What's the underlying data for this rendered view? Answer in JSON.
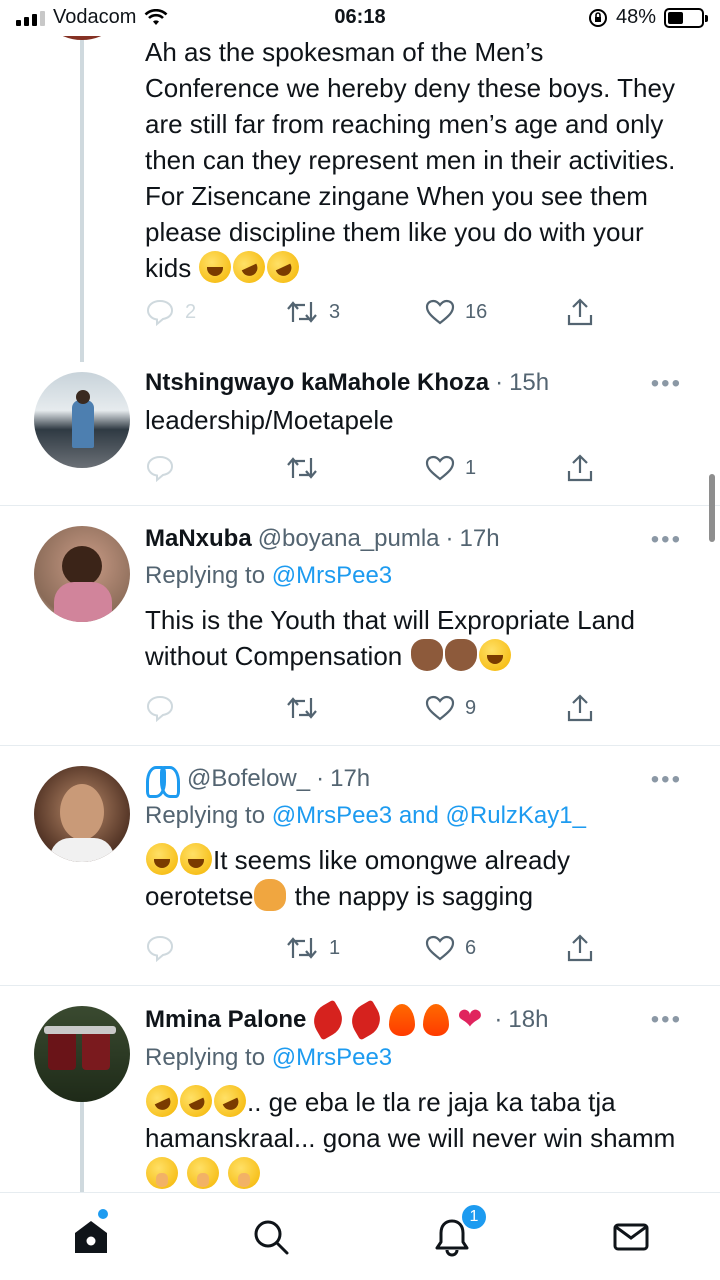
{
  "status_bar": {
    "carrier": "Vodacom",
    "time": "06:18",
    "battery_percent": "48%",
    "battery_level": 0.48
  },
  "tweets": [
    {
      "text": "Ah as the spokesman of the Men’s Conference we hereby deny these boys. They are still far from reaching men’s age and only then can they represent men in their activities. For Zisencane zingane When you see them please discipline them like you do with your kids",
      "emojis": [
        "face-with-tears-of-joy",
        "rolling-on-floor-laughing",
        "rolling-on-floor-laughing"
      ],
      "replies": "2",
      "retweets": "3",
      "likes": "16"
    },
    {
      "name": "Ntshingwayo kaMahole Khoza",
      "time": "15h",
      "text": "leadership/Moetapele",
      "replies": "",
      "retweets": "",
      "likes": "1"
    },
    {
      "name": "MaNxuba",
      "handle": "@boyana_pumla",
      "time": "17h",
      "replying_prefix": "Replying to",
      "replying_to": "@MrsPee3",
      "text": "This is the Youth that will Expropriate Land without Compensation",
      "emojis": [
        "clapping-hands",
        "clapping-hands",
        "face-with-tears-of-joy"
      ],
      "replies": "",
      "retweets": "",
      "likes": "9"
    },
    {
      "handle": "@Bofelow_",
      "time": "17h",
      "name_emoji": "butterfly",
      "replying_prefix": "Replying to",
      "replying_to": "@MrsPee3 and @RulzKay1_",
      "text_part1": "It seems like omongwe already oerotetse",
      "text_part2": " the nappy is sagging",
      "emojis_lead": [
        "face-with-tears-of-joy",
        "face-with-tears-of-joy"
      ],
      "emoji_mid": "person-facepalming",
      "replies": "",
      "retweets": "1",
      "likes": "6"
    },
    {
      "name": "Mmina Palone",
      "name_emojis": [
        "hot-pepper",
        "hot-pepper",
        "fire",
        "fire",
        "red-heart"
      ],
      "time": "18h",
      "replying_prefix": "Replying to",
      "replying_to": "@MrsPee3",
      "emojis_lead": [
        "rolling-on-floor-laughing",
        "rolling-on-floor-laughing",
        "rolling-on-floor-laughing"
      ],
      "text_part1": ".. ge eba le tla re jaja ka taba tja hamanskraal... gona we will never win shamm",
      "emojis_tail": [
        "face-with-hand-over-mouth",
        "face-with-hand-over-mouth",
        "face-with-hand-over-mouth"
      ]
    }
  ],
  "bottom_nav": {
    "items": [
      "home-icon",
      "search-icon",
      "notifications-icon",
      "messages-icon"
    ],
    "notification_count": "1"
  },
  "colors": {
    "accent": "#1d9bf0",
    "text": "#0f1419",
    "secondary": "#536471",
    "divider": "#e6ecf0"
  }
}
